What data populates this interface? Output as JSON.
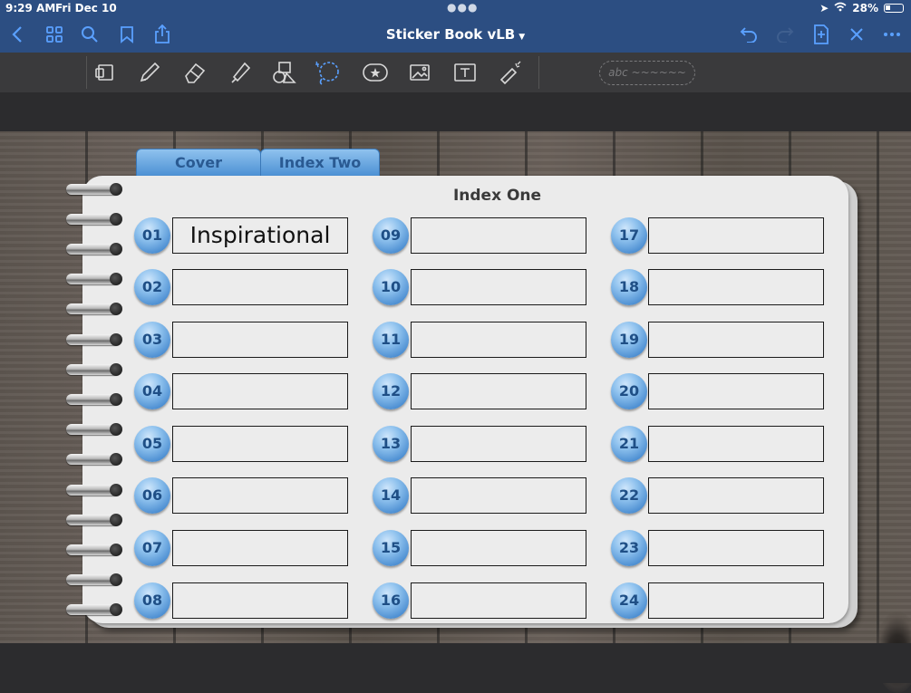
{
  "status": {
    "time": "9:29 AM",
    "date": "Fri Dec 10",
    "battery": "28%"
  },
  "nav": {
    "title": "Sticker Book vLB"
  },
  "toolbar": {
    "tools": [
      "read-mode",
      "pen",
      "eraser",
      "highlighter",
      "shapes",
      "lasso",
      "sticker",
      "image",
      "text",
      "laser-pointer"
    ],
    "textbox_placeholder": "abc ~~~~~~"
  },
  "tabs": [
    "Cover",
    "Index Two"
  ],
  "page": {
    "title": "Index One",
    "entries": [
      {
        "num": "01",
        "text": "Inspirational"
      },
      {
        "num": "02",
        "text": ""
      },
      {
        "num": "03",
        "text": ""
      },
      {
        "num": "04",
        "text": ""
      },
      {
        "num": "05",
        "text": ""
      },
      {
        "num": "06",
        "text": ""
      },
      {
        "num": "07",
        "text": ""
      },
      {
        "num": "08",
        "text": ""
      },
      {
        "num": "09",
        "text": ""
      },
      {
        "num": "10",
        "text": ""
      },
      {
        "num": "11",
        "text": ""
      },
      {
        "num": "12",
        "text": ""
      },
      {
        "num": "13",
        "text": ""
      },
      {
        "num": "14",
        "text": ""
      },
      {
        "num": "15",
        "text": ""
      },
      {
        "num": "16",
        "text": ""
      },
      {
        "num": "17",
        "text": ""
      },
      {
        "num": "18",
        "text": ""
      },
      {
        "num": "19",
        "text": ""
      },
      {
        "num": "20",
        "text": ""
      },
      {
        "num": "21",
        "text": ""
      },
      {
        "num": "22",
        "text": ""
      },
      {
        "num": "23",
        "text": ""
      },
      {
        "num": "24",
        "text": ""
      }
    ]
  },
  "colors": {
    "nav_bg": "#2c4e82",
    "accent": "#5aa0ff",
    "badge": "#4a8fd3",
    "page": "#ebebeb"
  }
}
